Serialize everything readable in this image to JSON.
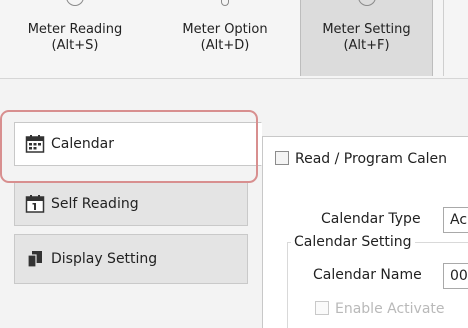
{
  "ribbon": {
    "buttons": [
      {
        "line1": "Meter Reading",
        "line2": "(Alt+S)"
      },
      {
        "line1": "Meter Option",
        "line2": "(Alt+D)"
      },
      {
        "line1": "Meter Setting",
        "line2": "(Alt+F)"
      }
    ],
    "selected": "Meter Setting"
  },
  "sidebar": {
    "items": [
      {
        "label": "Calendar",
        "icon": "calendar-icon",
        "active": true
      },
      {
        "label": "Self Reading",
        "icon": "calendar-day-icon",
        "active": false
      },
      {
        "label": "Display Setting",
        "icon": "display-icon",
        "active": false
      }
    ]
  },
  "content": {
    "read_program_label": "Read / Program Calen",
    "calendar_type_label": "Calendar Type",
    "calendar_type_value": "Ac",
    "calendar_setting_group": "Calendar Setting",
    "calendar_name_label": "Calendar Name",
    "calendar_name_value": "00",
    "enable_activate_label": "Enable Activate"
  },
  "colors": {
    "highlight": "#d88f8f",
    "selected_ribbon": "#dcdcdc",
    "inactive_tab": "#e4e4e4"
  }
}
